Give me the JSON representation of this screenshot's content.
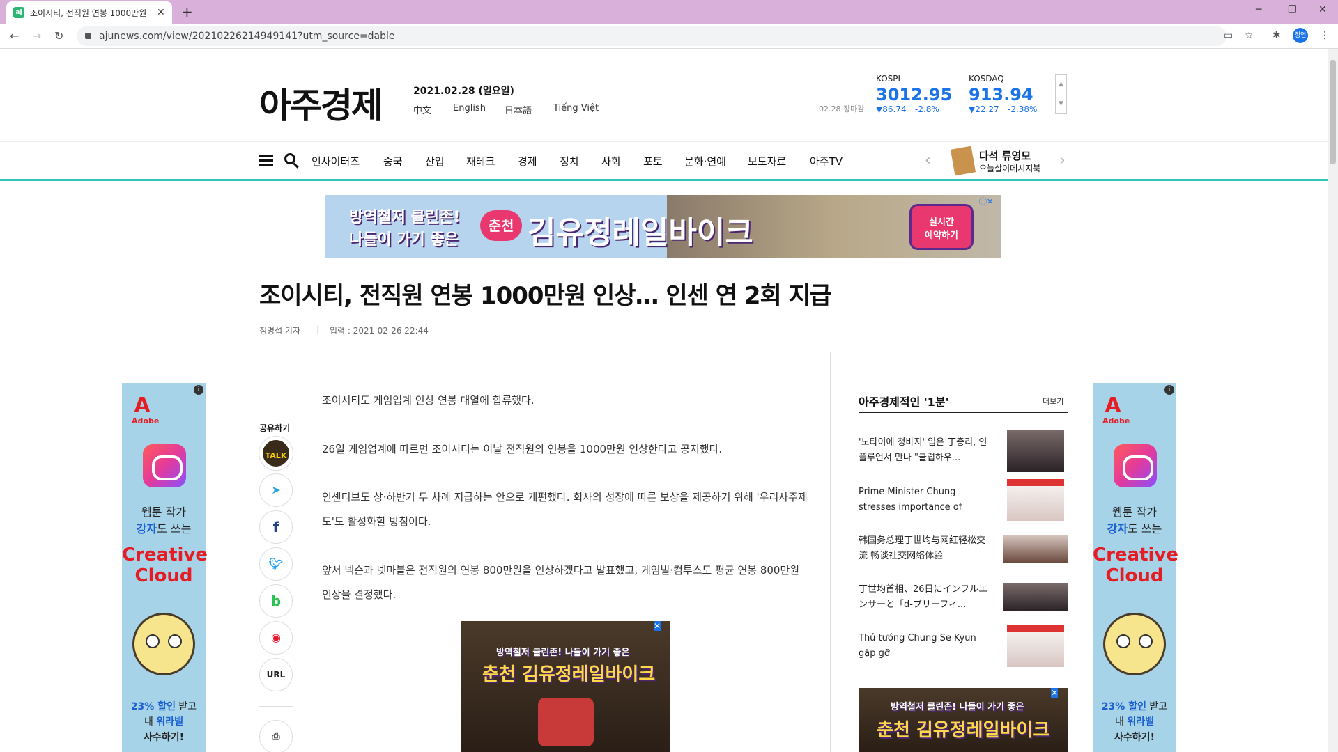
{
  "browser": {
    "tab_title": "조이시티, 전직원 연봉 1000만원",
    "favicon_text": "aj",
    "url": "ajunews.com/view/20210226214949141?utm_source=dable",
    "profile": "정연"
  },
  "header": {
    "logo": "아주경제",
    "date": "2021.02.28 (일요일)",
    "languages": [
      "中文",
      "English",
      "日本語",
      "Tiếng Việt"
    ],
    "closing_label": "02.28 장마감",
    "kospi": {
      "label": "KOSPI",
      "value": "3012.95",
      "change": "▼86.74",
      "pct": "-2.8%"
    },
    "kosdaq": {
      "label": "KOSDAQ",
      "value": "913.94",
      "change": "▼22.27",
      "pct": "-2.38%"
    }
  },
  "nav": {
    "items": [
      "인사이터즈",
      "중국",
      "산업",
      "재테크",
      "경제",
      "정치",
      "사회",
      "포토",
      "문화·연예",
      "보도자료",
      "아주TV"
    ],
    "book_title": "다석 류영모",
    "book_subtitle": "오늘살이메시지북"
  },
  "top_ad": {
    "line1": "방역철저 클린존!",
    "line2": "나들이 가기 좋은",
    "badge": "춘천",
    "main": "김유정레일바이크",
    "cta1": "실시간",
    "cta2": "예약하기"
  },
  "article": {
    "headline": "조이시티, 전직원 연봉 1000만원 인상… 인센 연 2회 지급",
    "reporter": "정명섭 기자",
    "input_label": "입력 : 2021-02-26 22:44",
    "paragraphs": [
      "조이시티도 게임업계 인상 연봉 대열에 합류했다.",
      "26일 게임업계에 따르면 조이시티는 이날 전직원의 연봉을 1000만원 인상한다고 공지했다.",
      "인센티브도 상·하반기 두 차례 지급하는 안으로 개편했다. 회사의 성장에 따른 보상을 제공하기 위해 '우리사주제도'도 활성화할 방침이다.",
      "앞서 넥슨과 넷마블은 전직원의 연봉 800만원을 인상하겠다고 발표했고, 게임빌·컴투스도 평균 연봉 800만원 인상을 결정했다."
    ]
  },
  "share": {
    "label": "공유하기",
    "buttons": [
      "TALK",
      "telegram",
      "f",
      "twitter",
      "b",
      "weibo",
      "URL",
      "print"
    ]
  },
  "inline_ad": {
    "top": "방역철저 클린존! 나들이 가기 좋은",
    "main": "춘천 김유정레일바이크"
  },
  "sidebar": {
    "title": "아주경제적인 '1분'",
    "more": "더보기",
    "items": [
      "'노타이에 청바지' 입은 丁총리, 인플루언서 만나 \"클럽하우...",
      "Prime Minister Chung stresses importance of 'borderless...",
      "韩国务总理丁世均与网红轻松交流 畅谈社交网络体验",
      "丁世均首相、26日にインフルエンサーと「d-ブリーフィ...",
      "Thủ tướng Chung Se Kyun gặp gỡ influencer...\"Clubhouse là..."
    ]
  },
  "side_ad": {
    "brand": "Adobe",
    "line1": "웹툰 작가",
    "line2a": "강자",
    "line2b": "도 쓰는",
    "product1": "Creative",
    "product2": "Cloud",
    "promo1a": "23% 할인",
    "promo1b": " 받고",
    "promo2a": "내 ",
    "promo2b": "워라밸",
    "promo3": "사수하기!"
  },
  "colors": {
    "accent": "#2ec4b6",
    "market": "#1a73e8",
    "tabbar": "#d8b0d9"
  }
}
